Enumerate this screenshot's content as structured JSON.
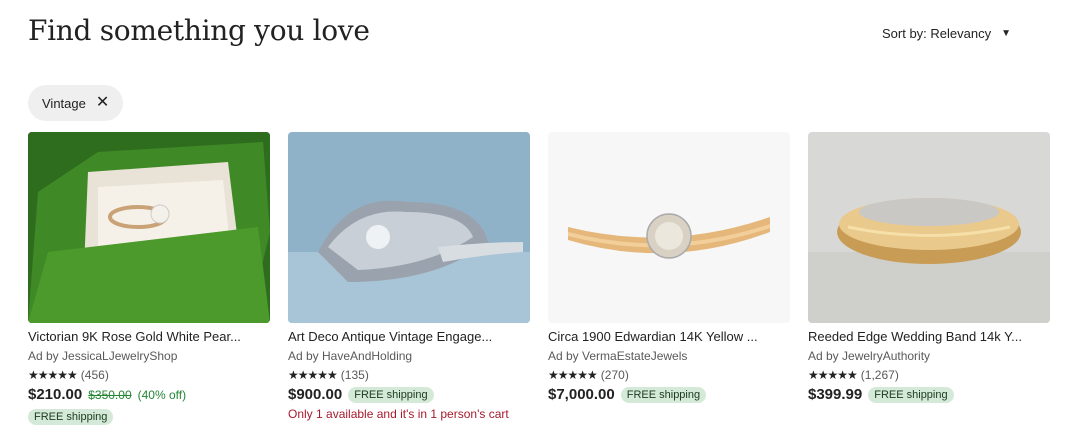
{
  "header": {
    "title": "Find something you love",
    "sort_label": "Sort by: Relevancy",
    "sort_caret": "▼"
  },
  "filters": [
    {
      "label": "Vintage",
      "remove_icon": "close-icon"
    }
  ],
  "products": [
    {
      "title": "Victorian 9K Rose Gold White Pear...",
      "shop": "Ad by JessicaLJewelryShop",
      "stars": "★★★★★",
      "reviews": "(456)",
      "price": "$210.00",
      "original_price": "$350.00",
      "discount": "(40% off)",
      "shipping": "FREE shipping",
      "stock_note": ""
    },
    {
      "title": "Art Deco Antique Vintage Engage...",
      "shop": "Ad by HaveAndHolding",
      "stars": "★★★★★",
      "reviews": "(135)",
      "price": "$900.00",
      "shipping": "FREE shipping",
      "stock_note": "Only 1 available and it's in 1 person's cart"
    },
    {
      "title": "Circa 1900 Edwardian 14K Yellow ...",
      "shop": "Ad by VermaEstateJewels",
      "stars": "★★★★★",
      "reviews": "(270)",
      "price": "$7,000.00",
      "shipping": "FREE shipping",
      "stock_note": ""
    },
    {
      "title": "Reeded Edge Wedding Band 14k Y...",
      "shop": "Ad by JewelryAuthority",
      "stars": "★★★★★",
      "reviews": "(1,267)",
      "price": "$399.99",
      "shipping": "FREE shipping",
      "stock_note": ""
    }
  ],
  "colors": {
    "free_shipping_bg": "#d4e9d7",
    "discount_green": "#258635",
    "stock_red": "#a61a2e"
  }
}
